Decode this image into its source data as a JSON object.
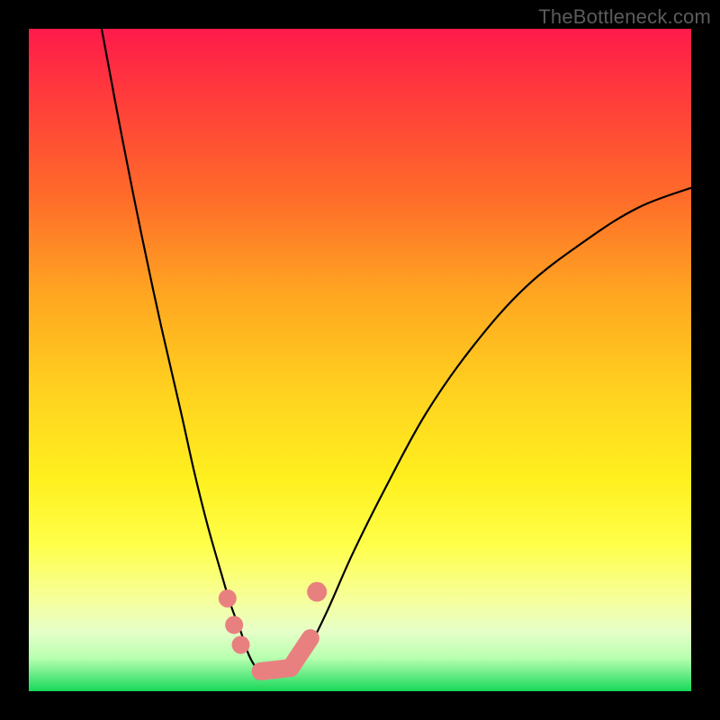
{
  "watermark": "TheBottleneck.com",
  "chart_data": {
    "type": "line",
    "title": "",
    "xlabel": "",
    "ylabel": "",
    "xlim": [
      0,
      100
    ],
    "ylim": [
      0,
      100
    ],
    "grid": false,
    "legend": false,
    "background_gradient": {
      "top": "#ff1a4b",
      "middle": "#ffe81f",
      "bottom": "#18d859"
    },
    "series": [
      {
        "name": "left-branch",
        "x": [
          11,
          14,
          17,
          20,
          23,
          25,
          27,
          29,
          30.5,
          32,
          33,
          34,
          35
        ],
        "values": [
          100,
          84,
          69,
          55,
          42,
          33,
          25,
          18,
          13,
          9,
          6,
          4,
          3
        ],
        "stroke": "#000000"
      },
      {
        "name": "right-branch",
        "x": [
          40,
          42,
          45,
          49,
          54,
          60,
          67,
          75,
          84,
          92,
          100
        ],
        "values": [
          3,
          6,
          12,
          21,
          31,
          42,
          52,
          61,
          68,
          73,
          76
        ],
        "stroke": "#000000"
      }
    ],
    "highlight_points": {
      "name": "pink-dots-near-trough",
      "color": "#e98080",
      "points": [
        {
          "x": 30,
          "y": 14
        },
        {
          "x": 31,
          "y": 10
        },
        {
          "x": 32,
          "y": 7
        },
        {
          "x": 35,
          "y": 3
        },
        {
          "x": 36.5,
          "y": 2.5
        },
        {
          "x": 38,
          "y": 2.7
        },
        {
          "x": 39.5,
          "y": 3.5
        },
        {
          "x": 41,
          "y": 5
        },
        {
          "x": 42.5,
          "y": 8
        },
        {
          "x": 43.5,
          "y": 15
        }
      ]
    },
    "annotations": []
  }
}
